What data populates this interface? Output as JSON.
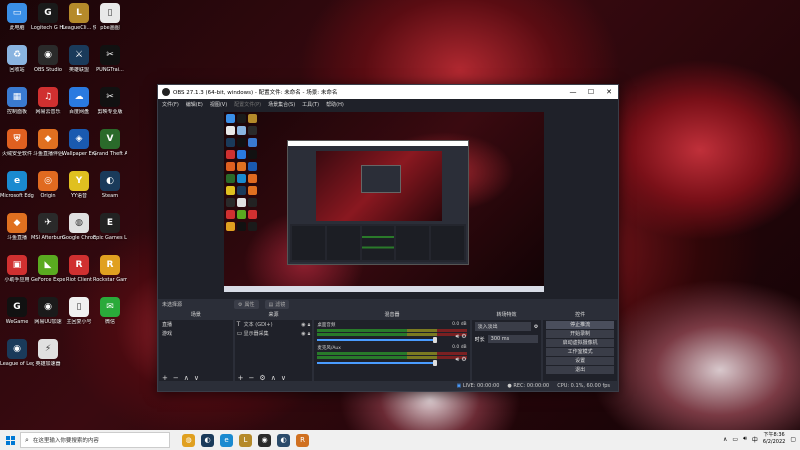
{
  "desktop": {
    "icons": [
      {
        "label": "此电脑",
        "icon": "computer-icon",
        "color": "#3a8ee6",
        "glyph": "▭"
      },
      {
        "label": "Logitech G HUB",
        "icon": "logitech-icon",
        "color": "#1a1a1a",
        "glyph": "G"
      },
      {
        "label": "LeagueCli... 快捷方式",
        "icon": "league-icon",
        "color": "#b58a2a",
        "glyph": "L"
      },
      {
        "label": "pbe画图",
        "icon": "file-icon",
        "color": "#e8e8e8",
        "glyph": "▯"
      },
      {
        "label": "回收站",
        "icon": "recycle-bin-icon",
        "color": "#8ab4e0",
        "glyph": "♻"
      },
      {
        "label": "OBS Studio",
        "icon": "obs-icon",
        "color": "#2a2a2a",
        "glyph": "◉"
      },
      {
        "label": "英雄联盟",
        "icon": "lol-icon",
        "color": "#1a3a5a",
        "glyph": "⚔"
      },
      {
        "label": "PUNGTrai...",
        "icon": "capcut-icon",
        "color": "#111111",
        "glyph": "✂"
      },
      {
        "label": "控制面板",
        "icon": "control-panel-icon",
        "color": "#3a7ad0",
        "glyph": "▦"
      },
      {
        "label": "网易云音乐",
        "icon": "netease-music-icon",
        "color": "#d03030",
        "glyph": "♫"
      },
      {
        "label": "百度网盘",
        "icon": "baidu-pan-icon",
        "color": "#2a7ae0",
        "glyph": "☁"
      },
      {
        "label": "剪映专业版",
        "icon": "jianying-icon",
        "color": "#111111",
        "glyph": "✂"
      },
      {
        "label": "火绒安全软件",
        "icon": "huorong-icon",
        "color": "#e06020",
        "glyph": "⛨"
      },
      {
        "label": "斗鱼直播伴侣",
        "icon": "douyu-icon",
        "color": "#e07020",
        "glyph": "◆"
      },
      {
        "label": "Wallpaper Engine",
        "icon": "wallpaper-engine-icon",
        "color": "#1a5ab0",
        "glyph": "◈"
      },
      {
        "label": "Grand Theft Auto V",
        "icon": "gta-icon",
        "color": "#2a6a2a",
        "glyph": "V"
      },
      {
        "label": "Microsoft Edge",
        "icon": "edge-icon",
        "color": "#1a8ad0",
        "glyph": "e"
      },
      {
        "label": "Origin",
        "icon": "origin-icon",
        "color": "#e06a20",
        "glyph": "◎"
      },
      {
        "label": "YY语音",
        "icon": "yy-icon",
        "color": "#e0c020",
        "glyph": "Y"
      },
      {
        "label": "Steam",
        "icon": "steam-icon",
        "color": "#1a3a5a",
        "glyph": "◐"
      },
      {
        "label": "斗鱼直播",
        "icon": "douyu-live-icon",
        "color": "#e07020",
        "glyph": "◆"
      },
      {
        "label": "MSI Afterburner",
        "icon": "msi-icon",
        "color": "#2a2a2a",
        "glyph": "✈"
      },
      {
        "label": "Google Chrome",
        "icon": "chrome-icon",
        "color": "#e0e0e0",
        "glyph": "◍"
      },
      {
        "label": "Epic Games Launcher",
        "icon": "epic-icon",
        "color": "#222222",
        "glyph": "E"
      },
      {
        "label": "小助手应用",
        "icon": "helper-app-icon",
        "color": "#d03030",
        "glyph": "▣"
      },
      {
        "label": "GeForce Experience",
        "icon": "geforce-icon",
        "color": "#5aaa20",
        "glyph": "◣"
      },
      {
        "label": "Riot Client",
        "icon": "riot-icon",
        "color": "#d03030",
        "glyph": "R"
      },
      {
        "label": "Rockstar Games...",
        "icon": "rockstar-icon",
        "color": "#e0a020",
        "glyph": "R"
      },
      {
        "label": "WeGame",
        "icon": "wegame-icon",
        "color": "#111111",
        "glyph": "G"
      },
      {
        "label": "网易UU加速",
        "icon": "uu-icon",
        "color": "#1a1a1a",
        "glyph": "◉"
      },
      {
        "label": "主回复小号",
        "icon": "text-file-icon",
        "color": "#f0f0f0",
        "glyph": "▯"
      },
      {
        "label": "微信",
        "icon": "wechat-icon",
        "color": "#2aaa3a",
        "glyph": "✉"
      },
      {
        "label": "League of Legends...",
        "icon": "league-of-legends-icon",
        "color": "#1a3a5a",
        "glyph": "◉"
      },
      {
        "label": "英雄加速器",
        "icon": "accelerator-icon",
        "color": "#e0e0e0",
        "glyph": "⚡"
      }
    ]
  },
  "obs": {
    "title": "OBS 27.1.3 (64-bit, windows) - 配置文件: 未命名 - 场景: 未命名",
    "window_controls": {
      "minimize": "—",
      "maximize": "☐",
      "close": "✕"
    },
    "menu": [
      "文件(F)",
      "编辑(E)",
      "视图(V)",
      "配置文件(P)",
      "场景集合(S)",
      "工具(T)",
      "帮助(H)"
    ],
    "no_source_label": "未选择源",
    "props_button": "属性",
    "filters_button": "滤镜",
    "scenes": {
      "header": "场景",
      "items": [
        "直播",
        "游戏"
      ]
    },
    "sources": {
      "header": "来源",
      "items": [
        {
          "name": "文本 (GDI+)",
          "icon": "text-icon",
          "glyph": "T"
        },
        {
          "name": "显示器采集",
          "icon": "monitor-icon",
          "glyph": "▭"
        }
      ]
    },
    "mixer": {
      "header": "混音器",
      "channels": [
        {
          "name": "桌面音频",
          "db": "0.0 dB",
          "level": 0.78
        },
        {
          "name": "麦克风/Aux",
          "db": "0.0 dB",
          "level": 0.78
        }
      ]
    },
    "transitions": {
      "header": "转场特效",
      "selected": "淡入淡出",
      "duration_label": "时长",
      "duration_value": "300 ms"
    },
    "controls": {
      "header": "控件",
      "buttons": [
        "停止推流",
        "开始录制",
        "启动虚拟摄像机",
        "工作室模式",
        "设置",
        "退出"
      ]
    },
    "status": {
      "live": "LIVE: 00:00:00",
      "rec": "REC: 00:00:00",
      "cpu": "CPU: 0.1%, 60.00 fps"
    }
  },
  "taskbar": {
    "search_placeholder": "在这里输入你要搜索的内容",
    "apps": [
      {
        "icon": "chrome-taskbar-icon",
        "color": "#e0a020",
        "glyph": "◍"
      },
      {
        "icon": "steam-taskbar-icon",
        "color": "#1a3a5a",
        "glyph": "◐"
      },
      {
        "icon": "edge-taskbar-icon",
        "color": "#1a8ad0",
        "glyph": "e"
      },
      {
        "icon": "league-taskbar-icon",
        "color": "#b58a2a",
        "glyph": "L"
      },
      {
        "icon": "obs-taskbar-icon",
        "color": "#2a2a2a",
        "glyph": "◉"
      },
      {
        "icon": "steam2-taskbar-icon",
        "color": "#2a4a6a",
        "glyph": "◐"
      },
      {
        "icon": "riot-taskbar-icon",
        "color": "#d07020",
        "glyph": "R"
      }
    ],
    "time": "下午8:36",
    "date": "6/2/2022"
  }
}
